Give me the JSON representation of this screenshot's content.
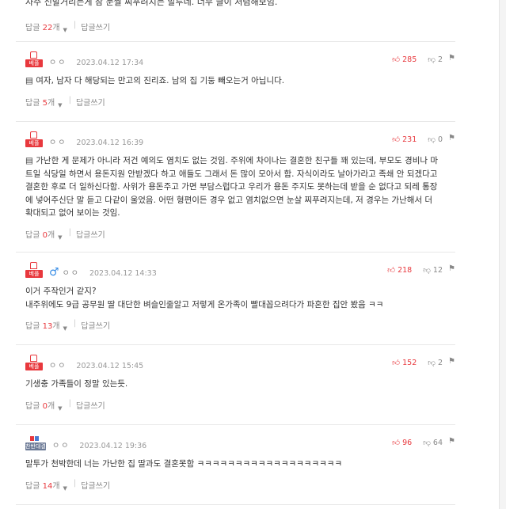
{
  "top_comment": {
    "text": "자주 신발거리는게 참 눈쌀 찌푸려지는 말투네. 너무 글이 저렴해보임.",
    "reply_label": "답글",
    "reply_count": "22",
    "reply_unit": "개",
    "write_label": "답글쓰기"
  },
  "comments": [
    {
      "badge": "베플",
      "gender": "",
      "nick": "ㅇㅇ",
      "date": "2023.04.12 17:34",
      "up": "285",
      "down": "2",
      "text": "▤ 여자, 남자 다 해당되는 만고의 진리죠. 남의 집 기둥 빼오는거 아닙니다.",
      "reply_label": "답글",
      "reply_count": "5",
      "reply_unit": "개",
      "write_label": "답글쓰기"
    },
    {
      "badge": "베플",
      "gender": "",
      "nick": "ㅇㅇ",
      "date": "2023.04.12 16:39",
      "up": "231",
      "down": "0",
      "text": "▤ 가난한 게 문제가 아니라 저건 예의도 염치도 없는 것임. 주위에 차이나는 결혼한 친구들 꽤 있는데, 부모도 경비나 마트일 식당일 하면서 용돈지원 안받겠다 하고 애들도 그래서 돈 많이 모아서 함. 자식이라도 날아가라고 족쇄 안 되겠다고 결혼한 후로 더 일하신다함. 사위가 용돈주고 가면 부담스럽다고 우리가 용돈 주지도 못하는데 받을 순 없다고 되레 통장에 넣어주신단 말 듣고 다같이 울었음. 어떤 형편이든 경우 없고 염치없으면 눈살 찌푸려지는데, 저 경우는 가난해서 더 확대되고 없어 보이는 것임.",
      "reply_label": "답글",
      "reply_count": "0",
      "reply_unit": "개",
      "write_label": "답글쓰기"
    },
    {
      "badge": "베플",
      "gender": "♂",
      "nick": "ㅇㅇ",
      "date": "2023.04.12 14:33",
      "up": "218",
      "down": "12",
      "text": "이거 주작인거 같지?\n내주위에도 9급 공무원 딸 대단한 벼슬인줄알고 저렇게 온가족이 빨대꼽으려다가 파혼한 집안 봤음 ㅋㅋ",
      "reply_label": "답글",
      "reply_count": "13",
      "reply_unit": "개",
      "write_label": "답글쓰기"
    },
    {
      "badge": "베플",
      "gender": "",
      "nick": "ㅇㅇ",
      "date": "2023.04.12 15:45",
      "up": "152",
      "down": "2",
      "text": "기생충 가족들이 정말 있는듯.",
      "reply_label": "답글",
      "reply_count": "0",
      "reply_unit": "개",
      "write_label": "답글쓰기"
    },
    {
      "badge": "찬반대결",
      "gender": "",
      "nick": "ㅇㅇ",
      "date": "2023.04.12 19:36",
      "up": "96",
      "down": "64",
      "text": "말투가 천박한데 너는 가난한 집 딸과도 결혼못함 ㅋㅋㅋㅋㅋㅋㅋㅋㅋㅋㅋㅋㅋㅋㅋㅋㅋㅋㅋ",
      "reply_label": "답글",
      "reply_count": "14",
      "reply_unit": "개",
      "write_label": "답글쓰기"
    }
  ],
  "icons": {
    "up": "thumb-up-icon",
    "down": "thumb-down-icon",
    "report": "report-icon",
    "expand": "triangle-down-icon"
  },
  "colors": {
    "accent": "#e8383d",
    "badge_vs": "#6c7a96",
    "gender": "#3a8ee6"
  }
}
